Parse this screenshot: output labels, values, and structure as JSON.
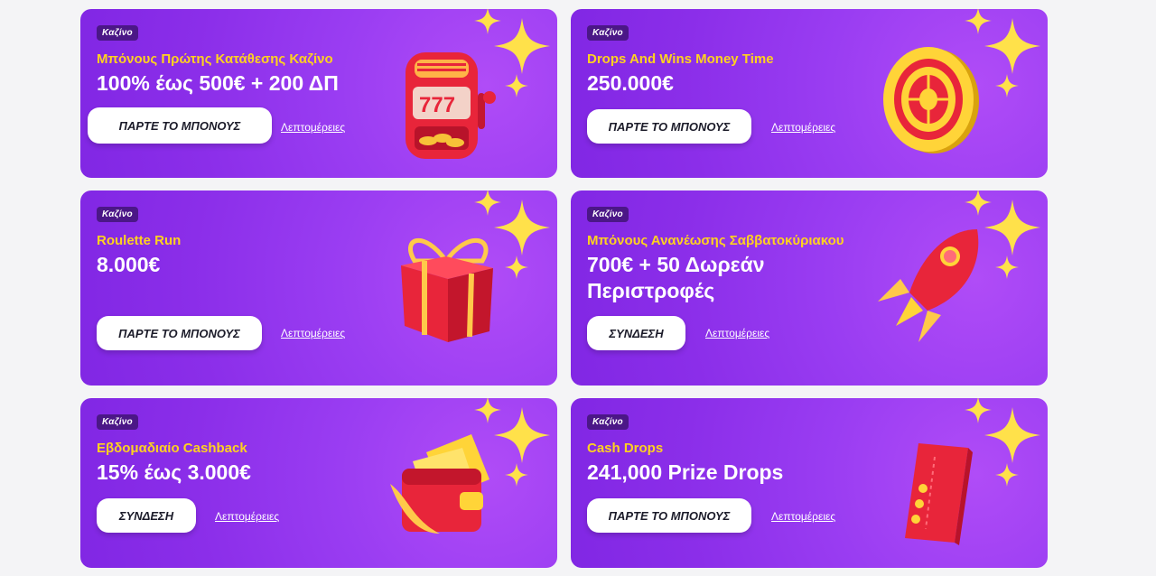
{
  "cards": [
    {
      "badge": "Καζίνο",
      "subtitle": "Μπόνους Πρώτης Κατάθεσης Καζίνο",
      "headline": "100% έως 500€ + 200 ΔΠ",
      "button": "ΠΑΡΤΕ ΤΟ ΜΠΟΝΟΥΣ",
      "link": "Λεπτομέρειες",
      "icon": "slot-machine-icon"
    },
    {
      "badge": "Καζίνο",
      "subtitle": "Drops And Wins Money Time",
      "headline": "250.000€",
      "button": "ΠΑΡΤΕ ΤΟ ΜΠΟΝΟΥΣ",
      "link": "Λεπτομέρειες",
      "icon": "roulette-wheel-icon"
    },
    {
      "badge": "Καζίνο",
      "subtitle": "Roulette Run",
      "headline": "8.000€",
      "button": "ΠΑΡΤΕ ΤΟ ΜΠΟΝΟΥΣ",
      "link": "Λεπτομέρειες",
      "icon": "gift-box-icon"
    },
    {
      "badge": "Καζίνο",
      "subtitle": "Μπόνους Ανανέωσης Σαββατοκύριακου",
      "headline": "700€ + 50 Δωρεάν Περιστροφές",
      "button": "ΣΥΝΔΕΣΗ",
      "link": "Λεπτομέρειες",
      "icon": "rocket-icon"
    },
    {
      "badge": "Καζίνο",
      "subtitle": "Εβδομαδιαίο Cashback",
      "headline": "15% έως 3.000€",
      "button": "ΣΥΝΔΕΣΗ",
      "link": "Λεπτομέρειες",
      "icon": "wallet-icon"
    },
    {
      "badge": "Καζίνο",
      "subtitle": "Cash Drops",
      "headline": "241,000 Prize Drops",
      "button": "ΠΑΡΤΕ ΤΟ ΜΠΟΝΟΥΣ",
      "link": "Λεπτομέρειες",
      "icon": "ticket-icon"
    }
  ],
  "colors": {
    "card_purple": "#8b2ee9",
    "subtitle_yellow": "#ffd21f",
    "badge_bg": "#4b1787",
    "page_bg": "#f4f4f6"
  }
}
